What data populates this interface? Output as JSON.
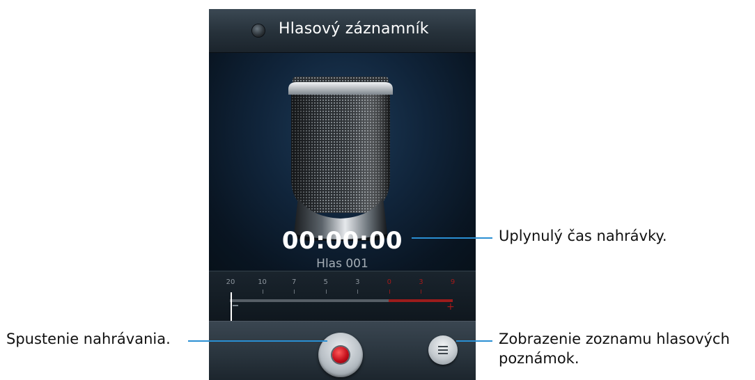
{
  "app": {
    "title": "Hlasový záznamník",
    "app_icon": "recorder-dot-icon"
  },
  "recorder": {
    "elapsed_time": "00:00:00",
    "file_name": "Hlas 001",
    "mic_image": "microphone-icon"
  },
  "level_meter": {
    "scale": [
      {
        "label": "20",
        "red": false
      },
      {
        "label": "10",
        "red": false
      },
      {
        "label": "7",
        "red": false
      },
      {
        "label": "5",
        "red": false
      },
      {
        "label": "3",
        "red": false
      },
      {
        "label": "0",
        "red": true
      },
      {
        "label": "3",
        "red": true
      },
      {
        "label": "9",
        "red": true
      }
    ],
    "minus_symbol": "–",
    "plus_symbol": "+",
    "level": 0
  },
  "controls": {
    "record_icon": "record-icon",
    "list_icon": "list-icon"
  },
  "callouts": {
    "elapsed": "Uplynulý čas nahrávky.",
    "record": "Spustenie nahrávania.",
    "list_line1": "Zobrazenie zoznamu hlasových",
    "list_line2": "poznámok."
  },
  "colors": {
    "accent_callout": "#2a8fd3",
    "record_red": "#c40f1c",
    "meter_red": "#9c1c1c"
  }
}
